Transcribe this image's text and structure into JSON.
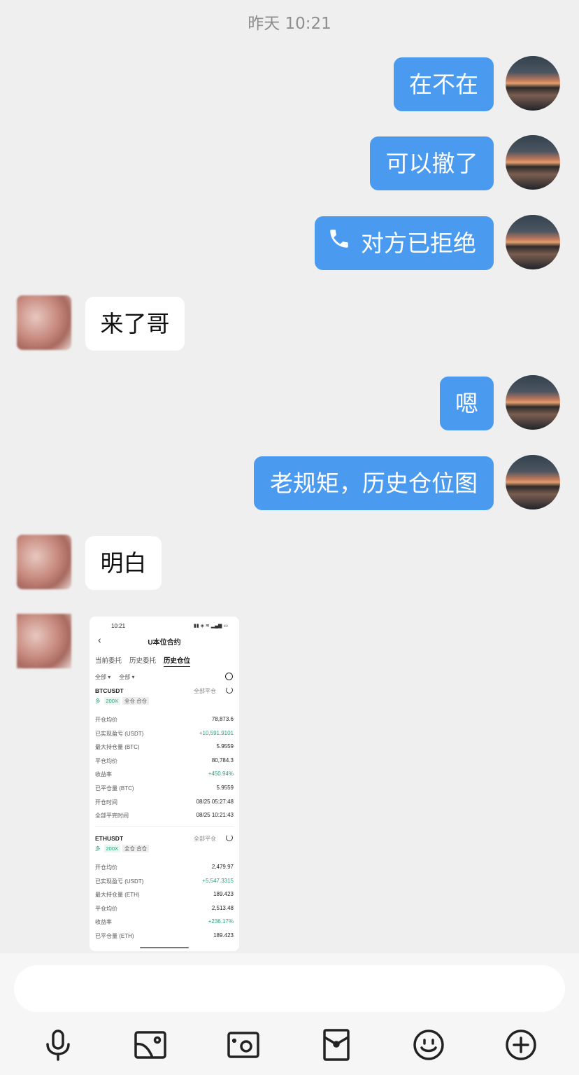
{
  "timestamp": "昨天 10:21",
  "messages": {
    "m1": "在不在",
    "m2": "可以撤了",
    "m3": "对方已拒绝",
    "m4": "来了哥",
    "m5": "嗯",
    "m6": "老规矩，历史仓位图",
    "m7": "明白"
  },
  "screenshot": {
    "status_time": "10:21",
    "title": "U本位合约",
    "tabs": [
      "当前委托",
      "历史委托",
      "历史仓位"
    ],
    "filters": [
      "全部 ▾",
      "全部 ▾"
    ],
    "close_all_label": "全部平仓",
    "long_tag": "多",
    "leverage": "200X",
    "margin_mode": "全仓 合仓",
    "positions": [
      {
        "symbol": "BTCUSDT",
        "rows": [
          {
            "k": "开仓均价",
            "v": "78,873.6"
          },
          {
            "k": "已实现盈亏 (USDT)",
            "v": "+10,591.9101"
          },
          {
            "k": "最大持仓量 (BTC)",
            "v": "5.9559"
          },
          {
            "k": "平仓均价",
            "v": "80,784.3"
          },
          {
            "k": "收益率",
            "v": "+450.94%"
          },
          {
            "k": "已平仓量 (BTC)",
            "v": "5.9559"
          },
          {
            "k": "开仓时间",
            "v": "08/25 05:27:48"
          },
          {
            "k": "全部平完时间",
            "v": "08/25 10:21:43"
          }
        ]
      },
      {
        "symbol": "ETHUSDT",
        "rows": [
          {
            "k": "开仓均价",
            "v": "2,479.97"
          },
          {
            "k": "已实现盈亏 (USDT)",
            "v": "+5,547.3315"
          },
          {
            "k": "最大持仓量 (ETH)",
            "v": "189.423"
          },
          {
            "k": "平仓均价",
            "v": "2,513.48"
          },
          {
            "k": "收益率",
            "v": "+236.17%"
          },
          {
            "k": "已平仓量 (ETH)",
            "v": "189.423"
          }
        ]
      }
    ]
  },
  "toolbar": [
    "mic-icon",
    "image-icon",
    "camera-icon",
    "red-packet-icon",
    "emoji-icon",
    "plus-icon"
  ],
  "colors": {
    "my_bubble": "#4a9bf0",
    "background": "#efefef",
    "positive": "#26a17b"
  }
}
